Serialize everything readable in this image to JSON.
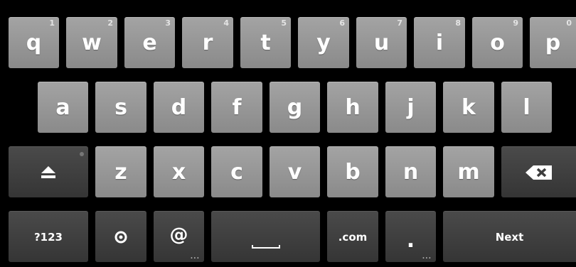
{
  "keyboard": {
    "row1": [
      {
        "label": "q",
        "alt": "1"
      },
      {
        "label": "w",
        "alt": "2"
      },
      {
        "label": "e",
        "alt": "3"
      },
      {
        "label": "r",
        "alt": "4"
      },
      {
        "label": "t",
        "alt": "5"
      },
      {
        "label": "y",
        "alt": "6"
      },
      {
        "label": "u",
        "alt": "7"
      },
      {
        "label": "i",
        "alt": "8"
      },
      {
        "label": "o",
        "alt": "9"
      },
      {
        "label": "p",
        "alt": "0"
      }
    ],
    "row2": [
      "a",
      "s",
      "d",
      "f",
      "g",
      "h",
      "j",
      "k",
      "l"
    ],
    "row3": [
      "z",
      "x",
      "c",
      "v",
      "b",
      "n",
      "m"
    ],
    "bottom": {
      "symbols_label": "?123",
      "at_label": "@",
      "dotcom_label": ".com",
      "period_label": ".",
      "next_label": "Next",
      "more_indicator": "..."
    },
    "icons": {
      "shift": "shift-arrow-icon",
      "backspace": "backspace-icon",
      "settings": "settings-gear-icon",
      "space": "space-bar-icon"
    },
    "colors": {
      "background": "#000000",
      "key_light": "#9a9a9a",
      "key_dark": "#404040",
      "text": "#ffffff"
    }
  }
}
